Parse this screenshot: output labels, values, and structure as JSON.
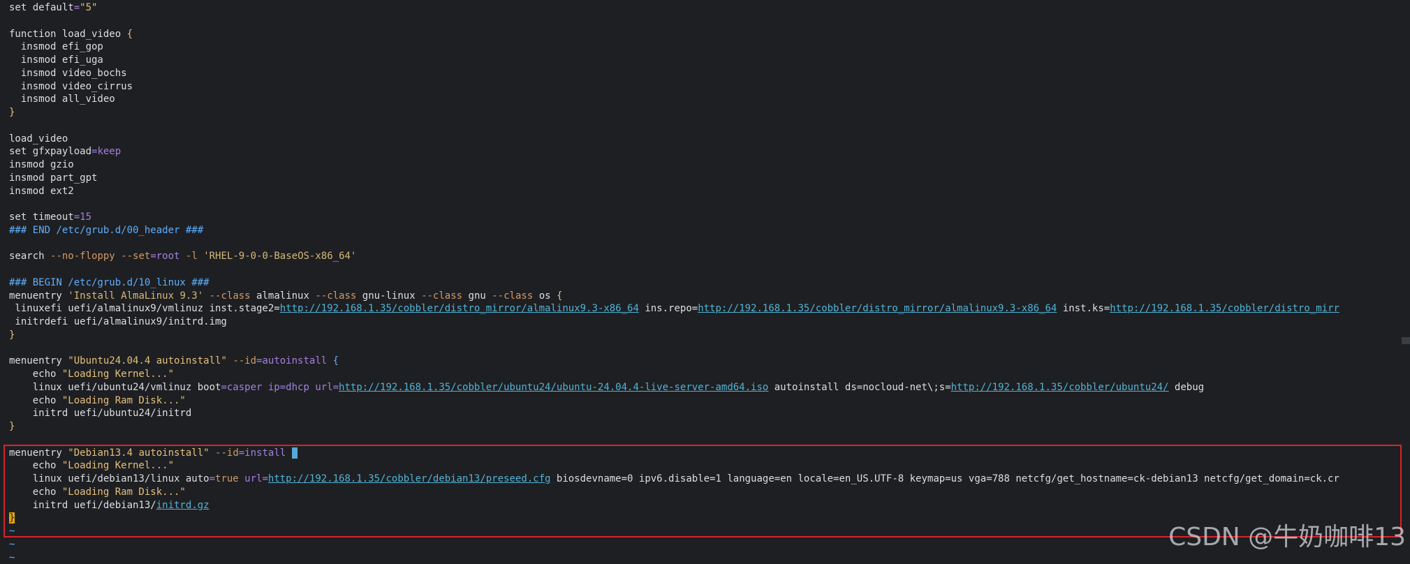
{
  "colors": {
    "background": "#1e1f22",
    "default": "#dcdfe4",
    "comment": "#5fafff",
    "keyword": "#a47fe1",
    "string": "#e5c07b",
    "string_single": "#d4b87a",
    "option": "#d19a66",
    "url": "#4fb4d8",
    "highlight_box": "#d9232e"
  },
  "editor": {
    "lines": [
      [
        [
          "default",
          "set default"
        ],
        [
          "keyword",
          "="
        ],
        [
          "string",
          "\"5\""
        ]
      ],
      [],
      [
        [
          "default",
          "function load_video "
        ],
        [
          "string",
          "{"
        ]
      ],
      [
        [
          "default",
          "  insmod efi_gop"
        ]
      ],
      [
        [
          "default",
          "  insmod efi_uga"
        ]
      ],
      [
        [
          "default",
          "  insmod video_bochs"
        ]
      ],
      [
        [
          "default",
          "  insmod video_cirrus"
        ]
      ],
      [
        [
          "default",
          "  insmod all_video"
        ]
      ],
      [
        [
          "string",
          "}"
        ]
      ],
      [],
      [
        [
          "default",
          "load_video"
        ]
      ],
      [
        [
          "default",
          "set gfxpayload"
        ],
        [
          "keyword",
          "=keep"
        ]
      ],
      [
        [
          "default",
          "insmod gzio"
        ]
      ],
      [
        [
          "default",
          "insmod part_gpt"
        ]
      ],
      [
        [
          "default",
          "insmod ext2"
        ]
      ],
      [],
      [
        [
          "default",
          "set timeout"
        ],
        [
          "keyword",
          "=15"
        ]
      ],
      [
        [
          "comment",
          "### END /etc/grub.d/00_header ###"
        ]
      ],
      [],
      [
        [
          "default",
          "search "
        ],
        [
          "option",
          "--no-floppy --set"
        ],
        [
          "keyword",
          "=root"
        ],
        [
          "default",
          " "
        ],
        [
          "option",
          "-l"
        ],
        [
          "default",
          " "
        ],
        [
          "string_single",
          "'RHEL-9-0-0-BaseOS-x86_64'"
        ]
      ],
      [],
      [
        [
          "comment",
          "### BEGIN /etc/grub.d/10_linux ###"
        ]
      ],
      [
        [
          "default",
          "menuentry "
        ],
        [
          "string_single",
          "'Install AlmaLinux 9.3'"
        ],
        [
          "default",
          " "
        ],
        [
          "option",
          "--class"
        ],
        [
          "default",
          " almalinux "
        ],
        [
          "option",
          "--class"
        ],
        [
          "default",
          " gnu-linux "
        ],
        [
          "option",
          "--class"
        ],
        [
          "default",
          " gnu "
        ],
        [
          "option",
          "--class"
        ],
        [
          "default",
          " os "
        ],
        [
          "string",
          "{"
        ]
      ],
      [
        [
          "default",
          " linuxefi uefi/almalinux9/vmlinuz inst.stage2="
        ],
        [
          "url",
          "http://192.168.1.35/cobbler/distro_mirror/almalinux9.3-x86_64"
        ],
        [
          "default",
          " ins.repo="
        ],
        [
          "url",
          "http://192.168.1.35/cobbler/distro_mirror/almalinux9.3-x86_64"
        ],
        [
          "default",
          " inst.ks="
        ],
        [
          "url",
          "http://192.168.1.35/cobbler/distro_mirr"
        ]
      ],
      [
        [
          "default",
          " initrdefi uefi/almalinux9/initrd.img"
        ]
      ],
      [
        [
          "string",
          "}"
        ]
      ],
      [],
      [
        [
          "default",
          "menuentry "
        ],
        [
          "string",
          "\"Ubuntu24.04.4 autoinstall\""
        ],
        [
          "default",
          " "
        ],
        [
          "option",
          "--id"
        ],
        [
          "keyword",
          "=autoinstall"
        ],
        [
          "default",
          " "
        ],
        [
          "comment",
          "{"
        ]
      ],
      [
        [
          "default",
          "    echo "
        ],
        [
          "string",
          "\"Loading Kernel...\""
        ]
      ],
      [
        [
          "default",
          "    linux uefi/ubuntu24/vmlinuz boot"
        ],
        [
          "keyword",
          "=casper ip=dhcp"
        ],
        [
          "default",
          " "
        ],
        [
          "keyword",
          "url="
        ],
        [
          "url",
          "http://192.168.1.35/cobbler/ubuntu24/ubuntu-24.04.4-live-server-amd64.iso"
        ],
        [
          "default",
          " autoinstall ds=nocloud-net\\;s="
        ],
        [
          "url",
          "http://192.168.1.35/cobbler/ubuntu24/"
        ],
        [
          "default",
          " debug"
        ]
      ],
      [
        [
          "default",
          "    echo "
        ],
        [
          "string",
          "\"Loading Ram Disk...\""
        ]
      ],
      [
        [
          "default",
          "    initrd uefi/ubuntu24/initrd"
        ]
      ],
      [
        [
          "string",
          "}"
        ]
      ],
      [],
      [
        [
          "default",
          "menuentry "
        ],
        [
          "string",
          "\"Debian13.4 autoinstall\""
        ],
        [
          "default",
          " "
        ],
        [
          "option",
          "--id"
        ],
        [
          "keyword",
          "=install"
        ],
        [
          "default",
          " "
        ],
        [
          "cursor",
          " "
        ]
      ],
      [
        [
          "default",
          "    echo "
        ],
        [
          "string",
          "\"Loading Kernel...\""
        ]
      ],
      [
        [
          "default",
          "    linux uefi/debian13/linux auto"
        ],
        [
          "keyword",
          "="
        ],
        [
          "option",
          "true"
        ],
        [
          "default",
          " "
        ],
        [
          "keyword",
          "url="
        ],
        [
          "url",
          "http://192.168.1.35/cobbler/debian13/preseed.cfg"
        ],
        [
          "default",
          " biosdevname=0 ipv6.disable=1 language=en locale=en_US.UTF-8 keymap=us vga=788 netcfg/get_hostname=ck-debian13 netcfg/get_domain=ck.cr"
        ]
      ],
      [
        [
          "default",
          "    echo "
        ],
        [
          "string",
          "\"Loading Ram Disk...\""
        ]
      ],
      [
        [
          "default",
          "    initrd uefi/debian13/"
        ],
        [
          "url",
          "initrd.gz"
        ]
      ],
      [
        [
          "brace",
          "}"
        ]
      ],
      [
        [
          "comment",
          "~"
        ]
      ],
      [
        [
          "comment",
          "~"
        ]
      ],
      [
        [
          "comment",
          "~"
        ]
      ]
    ]
  },
  "watermark": {
    "text": "CSDN @牛奶咖啡13"
  }
}
